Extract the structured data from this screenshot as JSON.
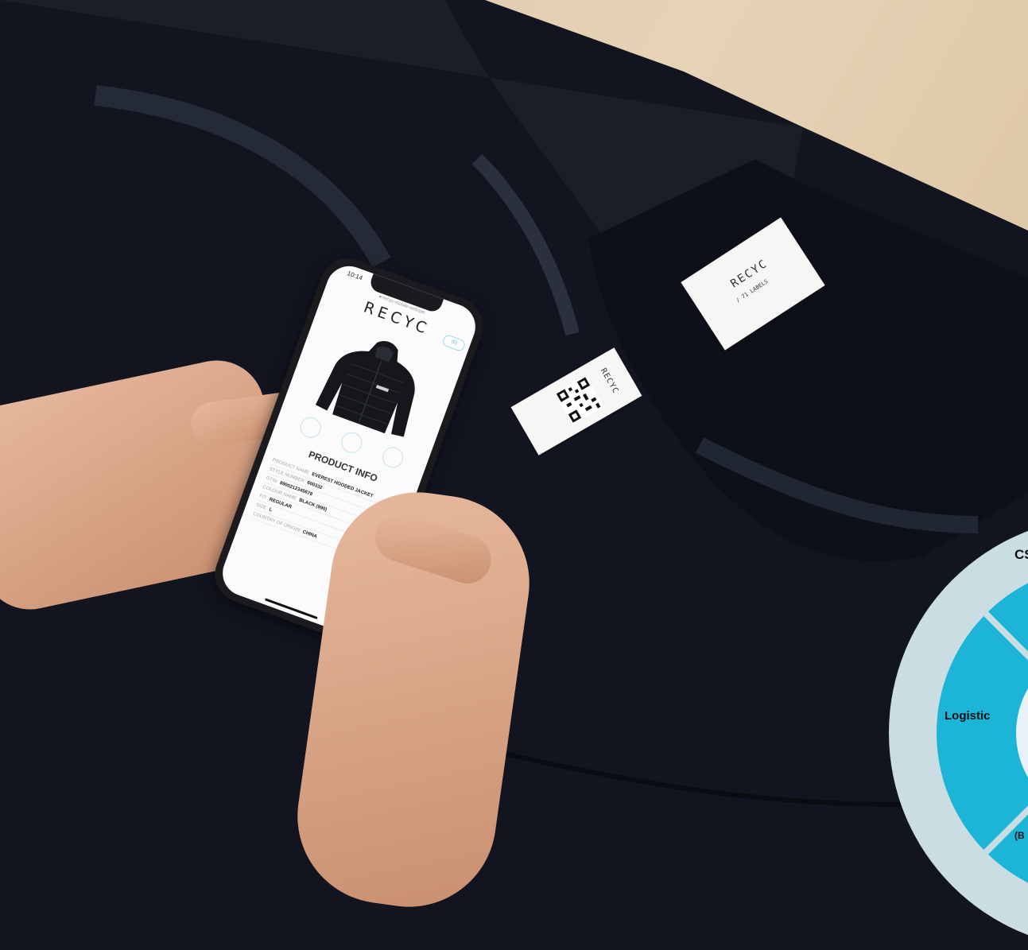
{
  "phone": {
    "status_time": "10:14",
    "url": "● recyc-mobile-website",
    "brand": "RECYC",
    "quantity_badge": "(0)",
    "product_info_title": "PRODUCT INFO",
    "rows": [
      {
        "key": "PRODUCT NAME",
        "value": "EVEREST HOODED JACKET"
      },
      {
        "key": "STYLE NUMBER",
        "value": "600332"
      },
      {
        "key": "GTIN",
        "value": "8900212345678"
      },
      {
        "key": "COLOUR NAME",
        "value": "BLACK (990)"
      },
      {
        "key": "FIT",
        "value": "REGULAR"
      },
      {
        "key": "SIZE",
        "value": "L"
      },
      {
        "key": "COUNTRY OF ORIGIN",
        "value": "CHINA"
      }
    ]
  },
  "labels": {
    "tag_brand": "RECYC",
    "tag_small": "/ 71 LABELS",
    "qr_label_brand": "RECYC"
  },
  "diagram": {
    "top_label": "CS",
    "left_label": "Logistic",
    "bottom_label": "(B",
    "colors": {
      "ring": "#c9dde3",
      "segment": "#1cb4d7",
      "center": "#d7ecf2"
    }
  },
  "colors": {
    "jacket": "#14171f",
    "table": "#dcc5a3",
    "skin": "#d9a487"
  }
}
